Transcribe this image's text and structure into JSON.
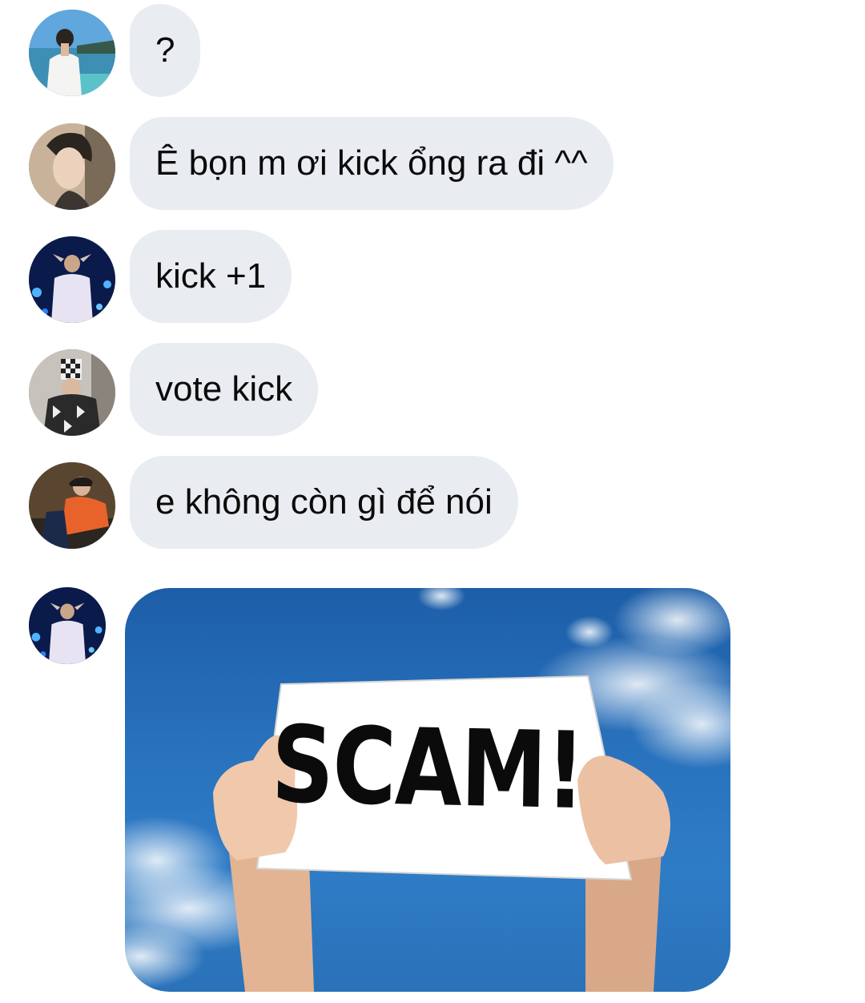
{
  "messages": [
    {
      "avatar": "avatar-man-on-boat",
      "text": "?"
    },
    {
      "avatar": "avatar-man-profile",
      "text": "Ê bọn m ơi kick ổng ra đi ^^"
    },
    {
      "avatar": "avatar-man-concert",
      "text": "kick +1"
    },
    {
      "avatar": "avatar-man-hat-over-face",
      "text": "vote kick"
    },
    {
      "avatar": "avatar-man-orange-shirt",
      "text": "e không còn gì để nói"
    }
  ],
  "image_message": {
    "avatar": "avatar-man-concert",
    "sign_text": "SCAM!"
  },
  "colors": {
    "bubble_bg": "#e9ecf0",
    "text": "#0a0a0a",
    "sky": "#2a74bf"
  }
}
